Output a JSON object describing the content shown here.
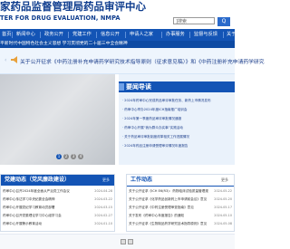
{
  "header": {
    "title_main": "家药品监督管理局药品审评中心",
    "title_sub": "TER FOR DRUG EVALUATION, NMPA",
    "search_placeholder": "]搜索",
    "search_button": "Q"
  },
  "nav": {
    "items": [
      "首页",
      "新闻中心",
      "政务公开",
      "党建工作",
      "信息公开",
      "申请人之家",
      "办事服务",
      "监督与反馈",
      "关于"
    ]
  },
  "ticker": {
    "text": "平新时代中国特色社会主义思想 学习贯彻党的二十届三中全会精神"
  },
  "banner": {
    "text": "关于公开征求《中药注册补充申请药学研究技术指导原则（征求意见稿）》和《中药注册补充申请药学研究",
    "prev_icon": "‹",
    "next_icon": "›"
  },
  "slider": {
    "dots": [
      "1",
      "2",
      "3",
      "4"
    ],
    "active_index": 0
  },
  "news": {
    "title": "要闻导读",
    "items": [
      "2024年药审中心完成药品审评审批任务、新药上市情况发布",
      "药审中心举办2024年度ICH指南推广培训会",
      "2024年第一季度药品审评审批情况通报",
      "药审中心开展“我为群众办实事”实践活动",
      "关于药品审评审批制度改革相关工作进展情况",
      "2024年药品注册申请受理审评情况年度报告"
    ]
  },
  "left_box": {
    "title": "党建动态（党风廉政建设）",
    "more": "更多",
    "rows": [
      {
        "text": "药审中心召开2024年度全面从严治党工作会议",
        "date": "2024-04-28"
      },
      {
        "text": "药审中心传达学习中央纪委全会精神",
        "date": "2024-03-22"
      },
      {
        "text": "药审中心开展党纪学习教育动员部署",
        "date": "2024-03-15"
      },
      {
        "text": "药审中心召开党委理论学习中心组学习会",
        "date": "2024-02-27"
      },
      {
        "text": "药审中心开展警示教育活动",
        "date": "2024-01-10"
      }
    ]
  },
  "right_box": {
    "title": "工作动态",
    "more": "更多",
    "rows": [
      {
        "text": "关于公开征求《ICH E6(R3)：药物临床试验质量管理规范》",
        "date": "2024-05-22"
      },
      {
        "text": "关于公开征求《化学药品创新药上市申请前会议》意见",
        "date": "2024-05-20"
      },
      {
        "text": "关于公开征求《中药注册受理审查指南》意见",
        "date": "2024-05-17"
      },
      {
        "text": "关于发布《药审中心年度报告》的通知",
        "date": "2024-05-10"
      },
      {
        "text": "关于公开征求《生物制品药学研究技术指导原则》意见",
        "date": "2024-05-08"
      }
    ]
  },
  "colors": {
    "brand": "#0f3d8e",
    "nav": "#1354b5",
    "panel": "#eaf2fb"
  }
}
